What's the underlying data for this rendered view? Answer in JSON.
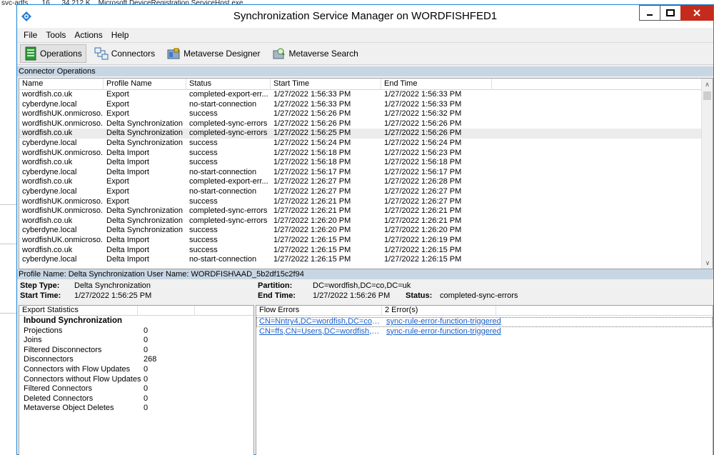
{
  "background": {
    "strip_text": "svc-adfs       16      34,212 K    Microsoft.DeviceRegistration.ServiceHost.exe"
  },
  "window": {
    "title": "Synchronization Service Manager on WORDFISHFED1"
  },
  "menu": [
    "File",
    "Tools",
    "Actions",
    "Help"
  ],
  "toolbar": {
    "operations": "Operations",
    "connectors": "Connectors",
    "metaverse_designer": "Metaverse Designer",
    "metaverse_search": "Metaverse Search"
  },
  "connector_operations": {
    "label": "Connector Operations",
    "columns": [
      "Name",
      "Profile Name",
      "Status",
      "Start Time",
      "End Time"
    ],
    "rows": [
      [
        "wordfish.co.uk",
        "Export",
        "completed-export-err...",
        "1/27/2022 1:56:33 PM",
        "1/27/2022 1:56:33 PM"
      ],
      [
        "cyberdyne.local",
        "Export",
        "no-start-connection",
        "1/27/2022 1:56:33 PM",
        "1/27/2022 1:56:33 PM"
      ],
      [
        "wordfishUK.onmicroso...",
        "Export",
        "success",
        "1/27/2022 1:56:26 PM",
        "1/27/2022 1:56:32 PM"
      ],
      [
        "wordfishUK.onmicroso...",
        "Delta Synchronization",
        "completed-sync-errors",
        "1/27/2022 1:56:26 PM",
        "1/27/2022 1:56:26 PM"
      ],
      [
        "wordfish.co.uk",
        "Delta Synchronization",
        "completed-sync-errors",
        "1/27/2022 1:56:25 PM",
        "1/27/2022 1:56:26 PM"
      ],
      [
        "cyberdyne.local",
        "Delta Synchronization",
        "success",
        "1/27/2022 1:56:24 PM",
        "1/27/2022 1:56:24 PM"
      ],
      [
        "wordfishUK.onmicroso...",
        "Delta Import",
        "success",
        "1/27/2022 1:56:18 PM",
        "1/27/2022 1:56:23 PM"
      ],
      [
        "wordfish.co.uk",
        "Delta Import",
        "success",
        "1/27/2022 1:56:18 PM",
        "1/27/2022 1:56:18 PM"
      ],
      [
        "cyberdyne.local",
        "Delta Import",
        "no-start-connection",
        "1/27/2022 1:56:17 PM",
        "1/27/2022 1:56:17 PM"
      ],
      [
        "wordfish.co.uk",
        "Export",
        "completed-export-err...",
        "1/27/2022 1:26:27 PM",
        "1/27/2022 1:26:28 PM"
      ],
      [
        "cyberdyne.local",
        "Export",
        "no-start-connection",
        "1/27/2022 1:26:27 PM",
        "1/27/2022 1:26:27 PM"
      ],
      [
        "wordfishUK.onmicroso...",
        "Export",
        "success",
        "1/27/2022 1:26:21 PM",
        "1/27/2022 1:26:27 PM"
      ],
      [
        "wordfishUK.onmicroso...",
        "Delta Synchronization",
        "completed-sync-errors",
        "1/27/2022 1:26:21 PM",
        "1/27/2022 1:26:21 PM"
      ],
      [
        "wordfish.co.uk",
        "Delta Synchronization",
        "completed-sync-errors",
        "1/27/2022 1:26:20 PM",
        "1/27/2022 1:26:21 PM"
      ],
      [
        "cyberdyne.local",
        "Delta Synchronization",
        "success",
        "1/27/2022 1:26:20 PM",
        "1/27/2022 1:26:20 PM"
      ],
      [
        "wordfishUK.onmicroso...",
        "Delta Import",
        "success",
        "1/27/2022 1:26:15 PM",
        "1/27/2022 1:26:19 PM"
      ],
      [
        "wordfish.co.uk",
        "Delta Import",
        "success",
        "1/27/2022 1:26:15 PM",
        "1/27/2022 1:26:15 PM"
      ],
      [
        "cyberdyne.local",
        "Delta Import",
        "no-start-connection",
        "1/27/2022 1:26:15 PM",
        "1/27/2022 1:26:15 PM"
      ]
    ],
    "selected_index": 4
  },
  "profile": {
    "text": "Profile Name: Delta Synchronization  User Name: WORDFISH\\AAD_5b2df15c2f94"
  },
  "details": {
    "step_type_label": "Step Type:",
    "step_type": "Delta Synchronization",
    "start_time_label": "Start Time:",
    "start_time": "1/27/2022 1:56:25 PM",
    "partition_label": "Partition:",
    "partition": "DC=wordfish,DC=co,DC=uk",
    "end_time_label": "End Time:",
    "end_time": "1/27/2022 1:56:26 PM",
    "status_label": "Status:",
    "status": "completed-sync-errors"
  },
  "export_statistics": {
    "header": "Export Statistics",
    "rows": [
      {
        "label": "Inbound Synchronization",
        "value": ""
      },
      {
        "label": "Projections",
        "value": "0"
      },
      {
        "label": "Joins",
        "value": "0"
      },
      {
        "label": "Filtered Disconnectors",
        "value": "0"
      },
      {
        "label": "Disconnectors",
        "value": "268"
      },
      {
        "label": "Connectors with Flow Updates",
        "value": "0"
      },
      {
        "label": "Connectors without Flow Updates",
        "value": "0"
      },
      {
        "label": "Filtered Connectors",
        "value": "0"
      },
      {
        "label": "Deleted Connectors",
        "value": "0"
      },
      {
        "label": "Metaverse Object Deletes",
        "value": "0"
      }
    ]
  },
  "flow_errors": {
    "header": "Flow Errors",
    "count_header": "2 Error(s)",
    "rows": [
      {
        "dn": "CN=Nntry4,DC=wordfish,DC=co,D...",
        "error": "sync-rule-error-function-triggered"
      },
      {
        "dn": "CN=ffs,CN=Users,DC=wordfish,DC...",
        "error": "sync-rule-error-function-triggered"
      }
    ]
  }
}
